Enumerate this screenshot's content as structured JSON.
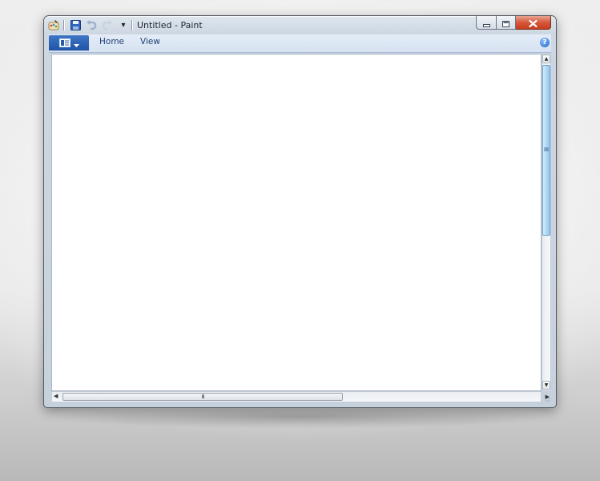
{
  "window": {
    "title": "Untitled - Paint"
  },
  "quick_access": {
    "icons": [
      "paint-app-icon",
      "save-icon",
      "undo-icon",
      "redo-icon",
      "customize-toolbar-icon"
    ],
    "customize_glyph": "▾"
  },
  "window_controls": {
    "icons": [
      "minimize-icon",
      "maximize-icon",
      "close-icon"
    ]
  },
  "ribbon": {
    "tabs": [
      {
        "label": "Home"
      },
      {
        "label": "View"
      }
    ],
    "app_menu_icon": "paint-menu-icon",
    "help_glyph": "?"
  },
  "scrollbars": {
    "up_glyph": "▲",
    "down_glyph": "▼",
    "left_glyph": "◀",
    "right_glyph": "▶",
    "h_grip": "III",
    "v_grip": "≡"
  },
  "colors": {
    "accent": "#1f53a6",
    "tab_text": "#1e3f74",
    "close_button": "#c73d1d",
    "canvas": "#ffffff"
  }
}
